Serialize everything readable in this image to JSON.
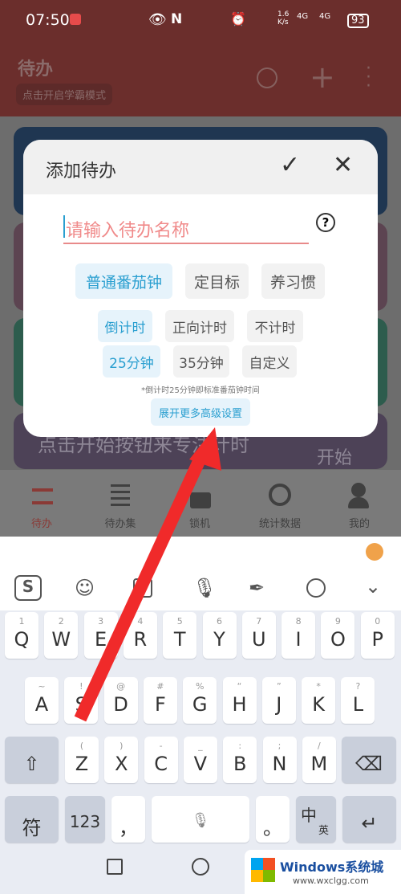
{
  "status": {
    "time": "07:50",
    "net_speed": "1.6 K/s",
    "signal1": "4G",
    "signal2": "4G",
    "battery": "93"
  },
  "header": {
    "title": "待办",
    "mode_button": "点击开启学霸模式"
  },
  "background": {
    "hint": "点击开始按钮来专注计时",
    "start": "开始"
  },
  "bottom_nav": [
    {
      "label": "待办",
      "active": true
    },
    {
      "label": "待办集"
    },
    {
      "label": "锁机"
    },
    {
      "label": "统计数据"
    },
    {
      "label": "我的"
    }
  ],
  "dialog": {
    "title": "添加待办",
    "name_placeholder": "请输入待办名称",
    "types": [
      {
        "label": "普通番茄钟",
        "selected": true
      },
      {
        "label": "定目标"
      },
      {
        "label": "养习惯"
      }
    ],
    "timer_modes": [
      {
        "label": "倒计时",
        "selected": true
      },
      {
        "label": "正向计时"
      },
      {
        "label": "不计时"
      }
    ],
    "durations": [
      {
        "label": "25分钟",
        "selected": true
      },
      {
        "label": "35分钟"
      },
      {
        "label": "自定义"
      }
    ],
    "hint": "*倒计时25分钟即标准番茄钟时间",
    "advanced": "展开更多高级设置"
  },
  "keyboard": {
    "row1": [
      [
        "1",
        "Q"
      ],
      [
        "2",
        "W"
      ],
      [
        "3",
        "E"
      ],
      [
        "4",
        "R"
      ],
      [
        "5",
        "T"
      ],
      [
        "6",
        "Y"
      ],
      [
        "7",
        "U"
      ],
      [
        "8",
        "I"
      ],
      [
        "9",
        "O"
      ],
      [
        "0",
        "P"
      ]
    ],
    "row2": [
      [
        "~",
        "A"
      ],
      [
        "!",
        "S"
      ],
      [
        "@",
        "D"
      ],
      [
        "#",
        "F"
      ],
      [
        "%",
        "G"
      ],
      [
        "“",
        "H"
      ],
      [
        "”",
        "J"
      ],
      [
        "*",
        "K"
      ],
      [
        "?",
        "L"
      ]
    ],
    "row3": [
      [
        "(",
        "Z"
      ],
      [
        ")",
        "X"
      ],
      [
        "-",
        "C"
      ],
      [
        "_",
        "V"
      ],
      [
        ":",
        "B"
      ],
      [
        ";",
        "N"
      ],
      [
        "/",
        "M"
      ]
    ],
    "symbols": "符",
    "numbers": "123",
    "comma": "，",
    "period": "。",
    "lang": "中",
    "lang_sub": "英"
  },
  "colors": {
    "accent": "#2a9fd0",
    "brand": "#6b2e2c",
    "arrow": "#f02a2a"
  },
  "watermark": {
    "text": "Windows系统城",
    "url": "www.wxclgg.com"
  }
}
